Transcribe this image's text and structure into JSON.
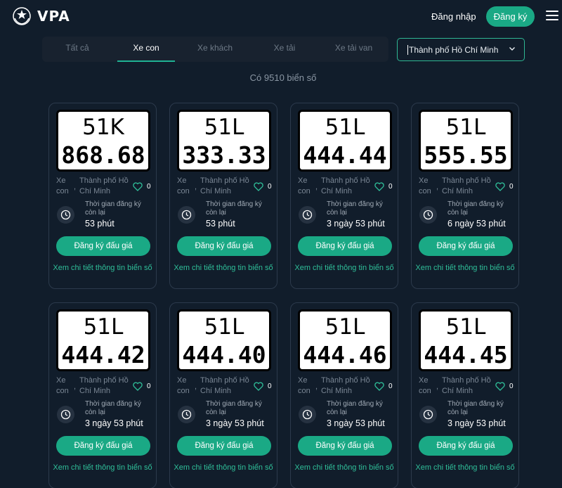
{
  "header": {
    "logo_text": "VPA",
    "login_label": "Đăng nhập",
    "register_label": "Đăng ký"
  },
  "tabs": [
    {
      "label": "Tất cả"
    },
    {
      "label": "Xe con",
      "active": true
    },
    {
      "label": "Xe khách"
    },
    {
      "label": "Xe tải"
    },
    {
      "label": "Xe tải van"
    }
  ],
  "city_select": {
    "value": "Thành phố Hồ Chí Minh"
  },
  "count_text": "Có 9510 biển số",
  "card_labels": {
    "vehicle_type": "Xe con",
    "separator": ",",
    "city": "Thành phố Hồ Chí Minh",
    "time_label": "Thời gian đăng ký còn lại",
    "bid_button": "Đăng ký đấu giá",
    "detail_link": "Xem chi tiết thông tin biển số"
  },
  "plates": [
    {
      "top": "51K",
      "bottom": "868.68",
      "favorites": "0",
      "time_left": "53 phút"
    },
    {
      "top": "51L",
      "bottom": "333.33",
      "favorites": "0",
      "time_left": "53 phút"
    },
    {
      "top": "51L",
      "bottom": "444.44",
      "favorites": "0",
      "time_left": "3 ngày 53 phút"
    },
    {
      "top": "51L",
      "bottom": "555.55",
      "favorites": "0",
      "time_left": "6 ngày 53 phút"
    },
    {
      "top": "51L",
      "bottom": "444.42",
      "favorites": "0",
      "time_left": "3 ngày 53 phút"
    },
    {
      "top": "51L",
      "bottom": "444.40",
      "favorites": "0",
      "time_left": "3 ngày 53 phút"
    },
    {
      "top": "51L",
      "bottom": "444.46",
      "favorites": "0",
      "time_left": "3 ngày 53 phút"
    },
    {
      "top": "51L",
      "bottom": "444.45",
      "favorites": "0",
      "time_left": "3 ngày 53 phút"
    }
  ],
  "colors": {
    "accent": "#1aa985",
    "background": "#111d2b",
    "link": "#2fbf99"
  }
}
